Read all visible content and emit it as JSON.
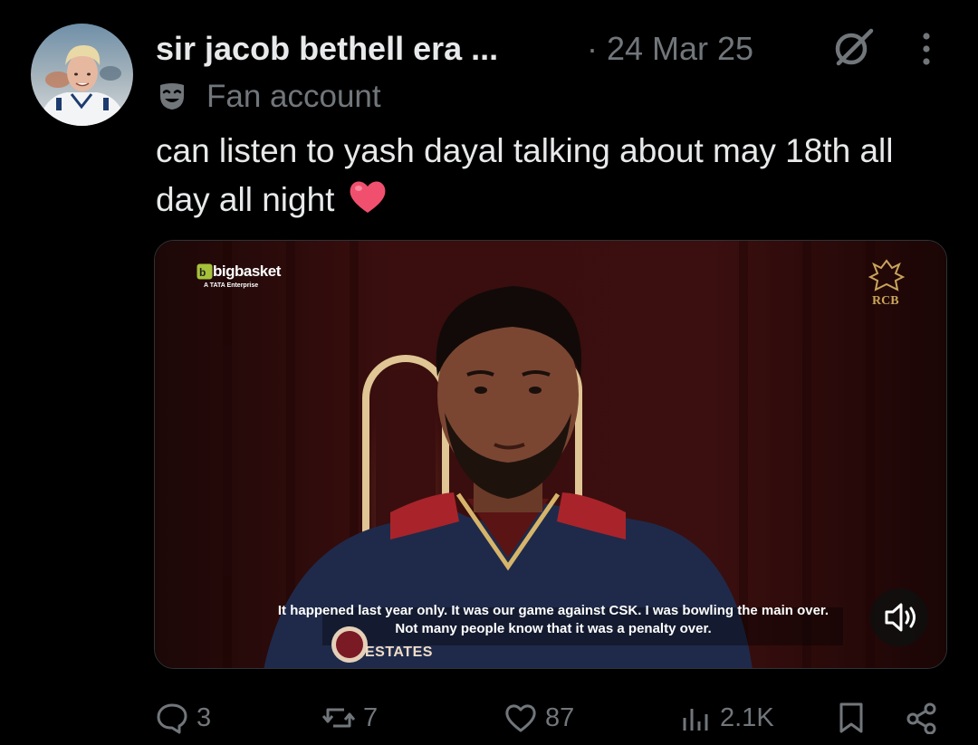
{
  "header": {
    "display_name": "sir jacob bethell era ...",
    "date": "· 24 Mar 25",
    "badge_label": "Fan account"
  },
  "tweet": {
    "text": "can listen to yash dayal talking about may 18th all day all night"
  },
  "video": {
    "sponsor_logo": "bigbasket",
    "sponsor_sub": "A TATA Enterprise",
    "subtitle_line1": "It happened last year only. It was our game against CSK. I was bowling the main over.",
    "subtitle_line2": "Not many people know that it was a penalty over.",
    "shirt_sponsor": "ESTATES"
  },
  "actions": {
    "replies": "3",
    "reposts": "7",
    "likes": "87",
    "views": "2.1K"
  },
  "colors": {
    "background": "#000000",
    "primary_text": "#e7e9ea",
    "secondary_text": "#71767b",
    "heart": "#f0506e"
  }
}
